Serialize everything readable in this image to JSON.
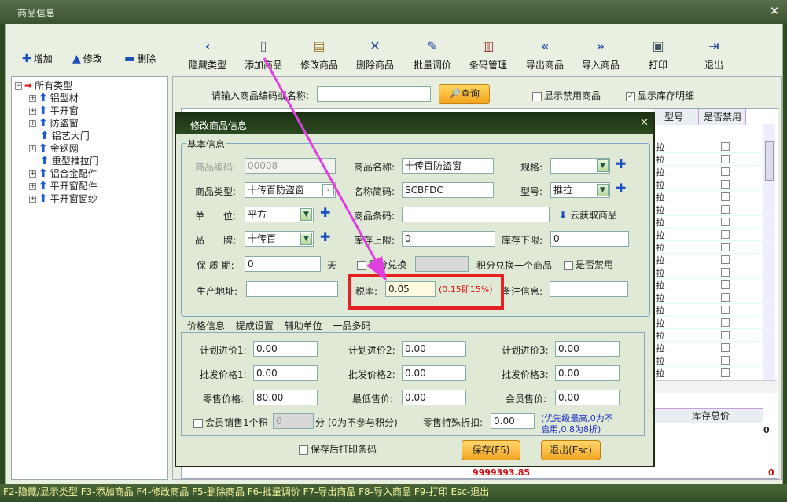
{
  "window": {
    "title": "商品信息"
  },
  "left_toolbar": [
    {
      "icon": "plus-icon",
      "label": "增加"
    },
    {
      "icon": "triangle-up-icon",
      "label": "修改"
    },
    {
      "icon": "minus-icon",
      "label": "删除"
    }
  ],
  "toolbar": [
    {
      "icon": "chevron-left-icon",
      "label": "隐藏类型"
    },
    {
      "icon": "document-icon",
      "label": "添加商品"
    },
    {
      "icon": "edit-document-icon",
      "label": "修改商品"
    },
    {
      "icon": "x-icon",
      "label": "删除商品"
    },
    {
      "icon": "pen-icon",
      "label": "批量调价"
    },
    {
      "icon": "barcode-icon",
      "label": "条码管理"
    },
    {
      "icon": "double-left-icon",
      "label": "导出商品"
    },
    {
      "icon": "double-right-icon",
      "label": "导入商品"
    },
    {
      "icon": "printer-icon",
      "label": "打印"
    },
    {
      "icon": "exit-icon",
      "label": "退出"
    }
  ],
  "tree": {
    "root": "所有类型",
    "items": [
      "铝型材",
      "平开窗",
      "防盗窗",
      "铝艺大门",
      "金钢网",
      "重型推拉门",
      "铝合金配件",
      "平开窗配件",
      "平开窗窗纱"
    ]
  },
  "search": {
    "label": "请输入商品编码或名称:",
    "value": "",
    "query_button": "查询",
    "show_disabled": "显示禁用商品",
    "show_stock_detail": "显示库存明细"
  },
  "grid": {
    "headers": [
      "型号",
      "是否禁用"
    ],
    "row_value": "拉",
    "bottom_header": "库存总价",
    "bottom_value": "0",
    "total_value": "9999393.85",
    "total_zero": "0"
  },
  "dialog": {
    "title": "修改商品信息",
    "basic_group": "基本信息",
    "fields": {
      "code_label": "商品编码:",
      "code_value": "00008",
      "name_label": "商品名称:",
      "name_value": "十传百防盗窗",
      "spec_label": "规格:",
      "spec_value": "",
      "type_label": "商品类型:",
      "type_value": "十传百防盗窗",
      "short_label": "名称简码:",
      "short_value": "SCBFDC",
      "model_label": "型号:",
      "model_value": "推拉",
      "unit_label": "单　　位:",
      "unit_value": "平方",
      "barcode_label": "商品条码:",
      "barcode_value": "",
      "cloud_label": "云获取商品",
      "brand_label": "品　　牌:",
      "brand_value": "十传百",
      "stock_max_label": "库存上限:",
      "stock_max_value": "0",
      "stock_min_label": "库存下限:",
      "stock_min_value": "0",
      "shelf_label": "保 质 期:",
      "shelf_value": "0",
      "shelf_unit": "天",
      "points_label": "积分兑换",
      "points_value": "",
      "points_note": "积分兑换一个商品",
      "disabled_label": "是否禁用",
      "addr_label": "生产地址:",
      "addr_value": "",
      "tax_label": "税率:",
      "tax_value": "0.05",
      "tax_hint": "(0.15即15%)",
      "remark_label": "备注信息:",
      "remark_value": ""
    },
    "tabs": [
      "价格信息",
      "提成设置",
      "辅助单位",
      "一品多码"
    ],
    "prices": {
      "p1_label": "计划进价1:",
      "p1": "0.00",
      "p2_label": "计划进价2:",
      "p2": "0.00",
      "p3_label": "计划进价3:",
      "p3": "0.00",
      "w1_label": "批发价格1:",
      "w1": "0.00",
      "w2_label": "批发价格2:",
      "w2": "0.00",
      "w3_label": "批发价格3:",
      "w3": "0.00",
      "retail_label": "零售价格:",
      "retail": "80.00",
      "min_label": "最低售价:",
      "min": "0.00",
      "member_label": "会员售价:",
      "member": "0.00",
      "member_points_label": "会员销售1个积",
      "member_points": "0",
      "member_points_note": "分 (0为不参与积分)",
      "discount_label": "零售特殊折扣:",
      "discount": "0.00",
      "discount_note_1": "(优先级最高,0为不",
      "discount_note_2": "启用,0.8为8折)"
    },
    "print_after_save": "保存后打印条码",
    "save_button": "保存(F5)",
    "exit_button": "退出(Esc)"
  },
  "footer": "F2-隐藏/显示类型  F3-添加商品  F4-修改商品  F5-删除商品  F6-批量调价  F7-导出商品  F8-导入商品  F9-打印  Esc-退出",
  "colors": {
    "accent": "#f2a526",
    "highlight": "#e62020",
    "arrow": "#e040e0",
    "hint": "#e01010"
  }
}
